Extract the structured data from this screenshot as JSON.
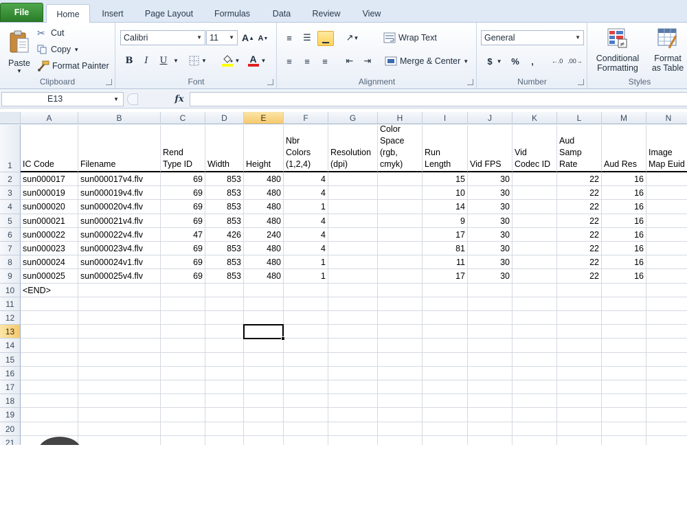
{
  "tabs": [
    {
      "label": "File"
    },
    {
      "label": "Home"
    },
    {
      "label": "Insert"
    },
    {
      "label": "Page Layout"
    },
    {
      "label": "Formulas"
    },
    {
      "label": "Data"
    },
    {
      "label": "Review"
    },
    {
      "label": "View"
    }
  ],
  "ribbon": {
    "clipboard": {
      "paste": "Paste",
      "cut": "Cut",
      "copy": "Copy",
      "format_painter": "Format Painter",
      "label": "Clipboard"
    },
    "font": {
      "name": "Calibri",
      "size": "11",
      "bold": "B",
      "italic": "I",
      "underline": "U",
      "grow": "A",
      "shrink": "A",
      "font_color": "A",
      "label": "Font"
    },
    "alignment": {
      "wrap": "Wrap Text",
      "merge": "Merge & Center",
      "label": "Alignment"
    },
    "number": {
      "format": "General",
      "currency": "$",
      "percent": "%",
      "comma": ",",
      "label": "Number"
    },
    "styles": {
      "conditional_l1": "Conditional",
      "conditional_l2": "Formatting",
      "table_l1": "Format",
      "table_l2": "as Table",
      "label": "Styles"
    }
  },
  "formula_bar": {
    "name_box": "E13",
    "fx": "fx",
    "formula": ""
  },
  "grid": {
    "columns": [
      "A",
      "B",
      "C",
      "D",
      "E",
      "F",
      "G",
      "H",
      "I",
      "J",
      "K",
      "L",
      "M",
      "N"
    ],
    "selected_column": "E",
    "selected_row": 13,
    "headers": [
      [
        "IC Code"
      ],
      [
        "Filename"
      ],
      [
        "Rend",
        "Type ID"
      ],
      [
        "Width"
      ],
      [
        "Height"
      ],
      [
        "Nbr",
        "Colors",
        "(1,2,4)"
      ],
      [
        "Resolution",
        "(dpi)"
      ],
      [
        "Color",
        "Space",
        "(rgb,",
        "cmyk)"
      ],
      [
        "Run",
        "Length"
      ],
      [
        "Vid FPS"
      ],
      [
        "Vid",
        "Codec ID"
      ],
      [
        "Aud",
        "Samp",
        "Rate"
      ],
      [
        "Aud Res"
      ],
      [
        "Image",
        "Map Euid"
      ]
    ],
    "rows": [
      [
        "sun000017",
        "sun000017v4.flv",
        "69",
        "853",
        "480",
        "4",
        "",
        "",
        "15",
        "30",
        "",
        "22",
        "16",
        ""
      ],
      [
        "sun000019",
        "sun000019v4.flv",
        "69",
        "853",
        "480",
        "4",
        "",
        "",
        "10",
        "30",
        "",
        "22",
        "16",
        ""
      ],
      [
        "sun000020",
        "sun000020v4.flv",
        "69",
        "853",
        "480",
        "1",
        "",
        "",
        "14",
        "30",
        "",
        "22",
        "16",
        ""
      ],
      [
        "sun000021",
        "sun000021v4.flv",
        "69",
        "853",
        "480",
        "4",
        "",
        "",
        "9",
        "30",
        "",
        "22",
        "16",
        ""
      ],
      [
        "sun000022",
        "sun000022v4.flv",
        "47",
        "426",
        "240",
        "4",
        "",
        "",
        "17",
        "30",
        "",
        "22",
        "16",
        ""
      ],
      [
        "sun000023",
        "sun000023v4.flv",
        "69",
        "853",
        "480",
        "4",
        "",
        "",
        "81",
        "30",
        "",
        "22",
        "16",
        ""
      ],
      [
        "sun000024",
        "sun000024v1.flv",
        "69",
        "853",
        "480",
        "1",
        "",
        "",
        "11",
        "30",
        "",
        "22",
        "16",
        ""
      ],
      [
        "sun000025",
        "sun000025v4.flv",
        "69",
        "853",
        "480",
        "1",
        "",
        "",
        "17",
        "30",
        "",
        "22",
        "16",
        ""
      ],
      [
        "<END>",
        "",
        "",
        "",
        "",
        "",
        "",
        "",
        "",
        "",
        "",
        "",
        "",
        ""
      ]
    ],
    "row_numbers": [
      "1",
      "2",
      "3",
      "4",
      "5",
      "6",
      "7",
      "8",
      "9",
      "10",
      "11",
      "12",
      "13",
      "14",
      "15",
      "16",
      "17",
      "18",
      "19",
      "20",
      "21"
    ]
  }
}
